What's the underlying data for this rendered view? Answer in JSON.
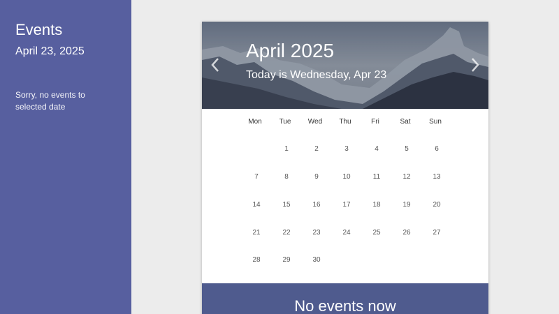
{
  "sidebar": {
    "title": "Events",
    "date": "April 23, 2025",
    "message": "Sorry, no events to selected date"
  },
  "calendar": {
    "month_title": "April 2025",
    "today_text": "Today is Wednesday, Apr 23",
    "prev_icon": "chevron-left-icon",
    "next_icon": "chevron-right-icon",
    "weekdays": [
      "Mon",
      "Tue",
      "Wed",
      "Thu",
      "Fri",
      "Sat",
      "Sun"
    ],
    "weeks": [
      [
        "",
        "1",
        "2",
        "3",
        "4",
        "5",
        "6"
      ],
      [
        "7",
        "8",
        "9",
        "10",
        "11",
        "12",
        "13"
      ],
      [
        "14",
        "15",
        "16",
        "17",
        "18",
        "19",
        "20"
      ],
      [
        "21",
        "22",
        "23",
        "24",
        "25",
        "26",
        "27"
      ],
      [
        "28",
        "29",
        "30",
        "",
        "",
        "",
        ""
      ]
    ]
  },
  "footer": {
    "no_events": "No events now"
  },
  "colors": {
    "sidebar_bg": "#575f9f",
    "footer_bg": "#4f5b8e",
    "page_bg": "#ececec"
  }
}
